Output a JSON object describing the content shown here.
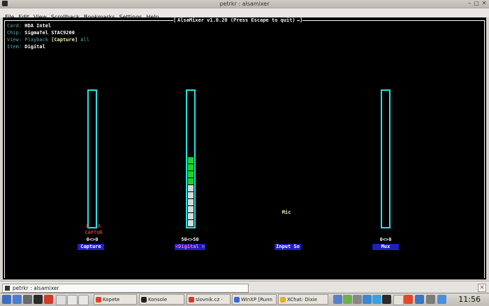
{
  "window": {
    "title": "petrkr : alsamixer",
    "min": "–",
    "max": "▢",
    "close": "✕"
  },
  "menu": [
    "File",
    "Edit",
    "View",
    "Scrollback",
    "Bookmarks",
    "Settings",
    "Help"
  ],
  "mixer": {
    "header": "AlsaMixer v1.0.20 (Press Escape to quit)",
    "bracket_left": "[",
    "bracket_right": "]",
    "card_label": "Card:",
    "card_value": "HDA Intel",
    "chip_label": "Chip:",
    "chip_value": "SigmaTel STAC9200",
    "view_label": "View:",
    "view_playback": "Playback",
    "view_capture": "[Capture]",
    "view_all": "All",
    "item_label": "Item:",
    "item_value": "Digital",
    "controls": [
      {
        "name": "Capture",
        "values": "0<>0",
        "left": "L",
        "right": "R",
        "captur": "CAPTUR",
        "level": 0.0
      },
      {
        "name": "<Digital >",
        "values": "50<>50",
        "level": 0.5
      },
      {
        "name": "Input So",
        "values": "",
        "mic": "Mic"
      },
      {
        "name": "Mux",
        "values": "0<>0",
        "level": 0.0
      }
    ]
  },
  "taskentry": {
    "label": "petrkr : alsamixer"
  },
  "panel": {
    "tasks": [
      "Kopete",
      "Konsole",
      "slovnik.cz -",
      "WinXP [Runn",
      "XChat: Dixie"
    ],
    "clock": "11:56"
  },
  "colors": {
    "meter_border": "#26e3e3",
    "meter_on": "#1fd31f",
    "meter_off": "#d9d9d9",
    "name_bg": "#1f1fbe"
  }
}
